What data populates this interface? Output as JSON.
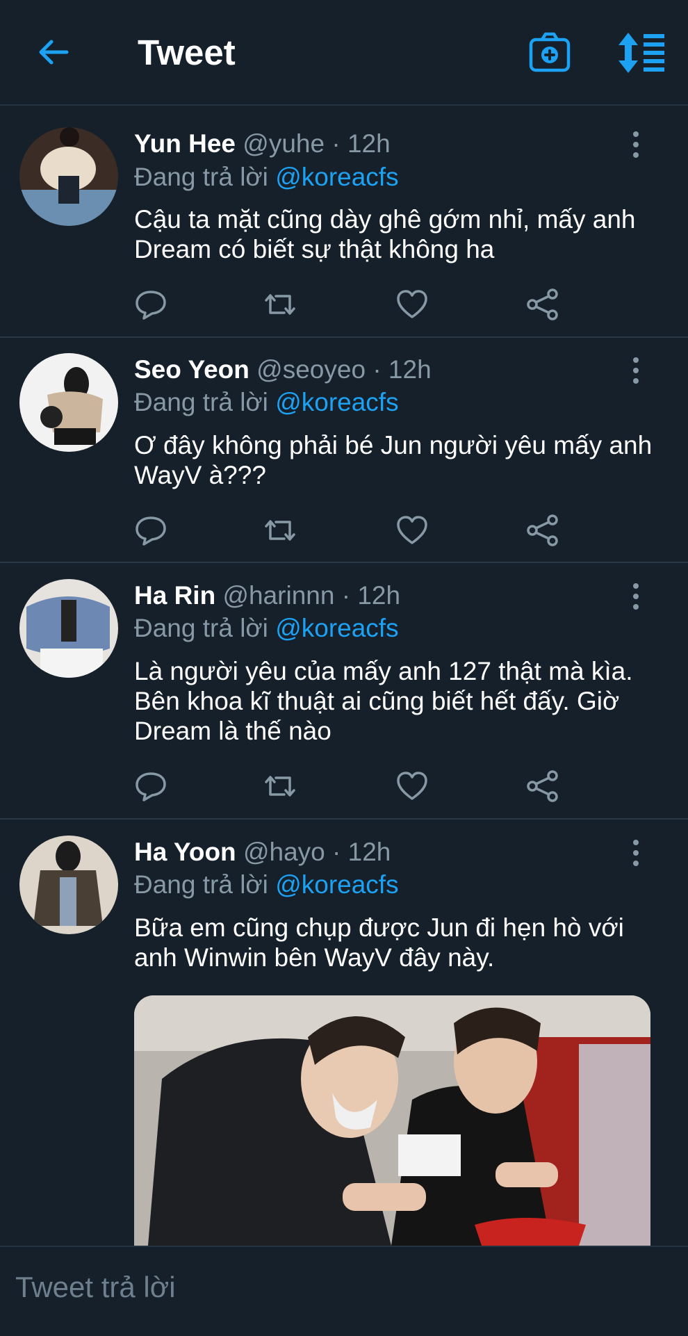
{
  "header": {
    "title": "Tweet"
  },
  "tweets": [
    {
      "name": "Yun Hee",
      "handle": "@yuhe",
      "time": "· 12h",
      "reply_prefix": "Đang trả lời",
      "reply_to": "@koreacfs",
      "text": "Cậu ta mặt cũng dày ghê gớm nhỉ, mấy anh Dream có biết sự thật không ha"
    },
    {
      "name": "Seo Yeon",
      "handle": "@seoyeo",
      "time": "· 12h",
      "reply_prefix": "Đang trả lời",
      "reply_to": "@koreacfs",
      "text": "Ơ đây không phải bé Jun người yêu mấy anh WayV à???"
    },
    {
      "name": "Ha Rin",
      "handle": "@harinnn",
      "time": "· 12h",
      "reply_prefix": "Đang trả lời",
      "reply_to": "@koreacfs",
      "text": "Là người yêu của mấy anh 127 thật mà kìa. Bên khoa kĩ thuật ai cũng biết hết đấy. Giờ Dream là thế nào"
    },
    {
      "name": "Ha Yoon",
      "handle": "@hayo",
      "time": "· 12h",
      "reply_prefix": "Đang trả lời",
      "reply_to": "@koreacfs",
      "text": "Bữa em cũng chụp được Jun đi hẹn hò với anh Winwin bên WayV đây này."
    }
  ],
  "composer": {
    "placeholder": "Tweet trả lời"
  },
  "colors": {
    "background": "#15202b",
    "accent": "#1da1f2",
    "secondary_text": "#8899a6",
    "divider": "#2b3947"
  }
}
